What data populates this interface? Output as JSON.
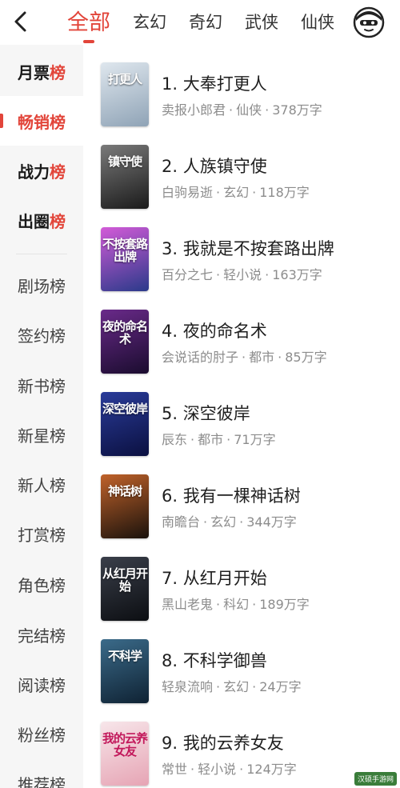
{
  "header": {
    "tabs": [
      {
        "label": "全部",
        "active": true
      },
      {
        "label": "玄幻",
        "active": false
      },
      {
        "label": "奇幻",
        "active": false
      },
      {
        "label": "武侠",
        "active": false
      },
      {
        "label": "仙侠",
        "active": false
      }
    ],
    "back_icon": "chevron-left-icon",
    "profile_icon": "mascot-avatar-icon"
  },
  "sidebar": {
    "featured": [
      {
        "prefix": "月票",
        "suffix": "榜"
      },
      {
        "prefix": "畅销",
        "suffix": "榜",
        "active": true
      },
      {
        "prefix": "战力",
        "suffix": "榜"
      },
      {
        "prefix": "出圈",
        "suffix": "榜"
      }
    ],
    "items": [
      "剧场榜",
      "签约榜",
      "新书榜",
      "新星榜",
      "新人榜",
      "打赏榜",
      "角色榜",
      "完结榜",
      "阅读榜",
      "粉丝榜",
      "推荐榜"
    ]
  },
  "books": [
    {
      "title": "1. 大奉打更人",
      "author": "卖报小郎君",
      "genre": "仙侠",
      "words": "378万字",
      "cover_text": "打更人",
      "cover_colors": [
        "#dfe7ee",
        "#8fa3b6"
      ]
    },
    {
      "title": "2. 人族镇守使",
      "author": "白驹易逝",
      "genre": "玄幻",
      "words": "118万字",
      "cover_text": "镇守使",
      "cover_colors": [
        "#7a7a7a",
        "#1a1a1a"
      ]
    },
    {
      "title": "3. 我就是不按套路出牌",
      "author": "百分之七",
      "genre": "轻小说",
      "words": "163万字",
      "cover_text": "不按套路出牌",
      "cover_colors": [
        "#d35bd8",
        "#2a3a8a"
      ]
    },
    {
      "title": "4. 夜的命名术",
      "author": "会说话的肘子",
      "genre": "都市",
      "words": "85万字",
      "cover_text": "夜的命名术",
      "cover_colors": [
        "#6a2a8a",
        "#1a0c2e"
      ]
    },
    {
      "title": "5. 深空彼岸",
      "author": "辰东",
      "genre": "都市",
      "words": "71万字",
      "cover_text": "深空彼岸",
      "cover_colors": [
        "#2a3c9a",
        "#0b1040"
      ]
    },
    {
      "title": "6. 我有一棵神话树",
      "author": "南瞻台",
      "genre": "玄幻",
      "words": "344万字",
      "cover_text": "神话树",
      "cover_colors": [
        "#c0622a",
        "#1a120c"
      ]
    },
    {
      "title": "7. 从红月开始",
      "author": "黑山老鬼",
      "genre": "科幻",
      "words": "189万字",
      "cover_text": "从红月开始",
      "cover_colors": [
        "#3a3f4a",
        "#0c0e12"
      ]
    },
    {
      "title": "8. 不科学御兽",
      "author": "轻泉流响",
      "genre": "玄幻",
      "words": "24万字",
      "cover_text": "不科学",
      "cover_colors": [
        "#3b6b8a",
        "#0f2233"
      ]
    },
    {
      "title": "9. 我的云养女友",
      "author": "常世",
      "genre": "轻小说",
      "words": "124万字",
      "cover_text": "我的云养女友",
      "cover_colors": [
        "#f7e6ea",
        "#e6a4b4"
      ]
    }
  ],
  "meta_separator": "·",
  "watermark": "汉硕手游网",
  "colors": {
    "accent": "#e2453a",
    "sidebar_bg": "#f6f6f6",
    "meta_text": "#8c8c8c"
  }
}
